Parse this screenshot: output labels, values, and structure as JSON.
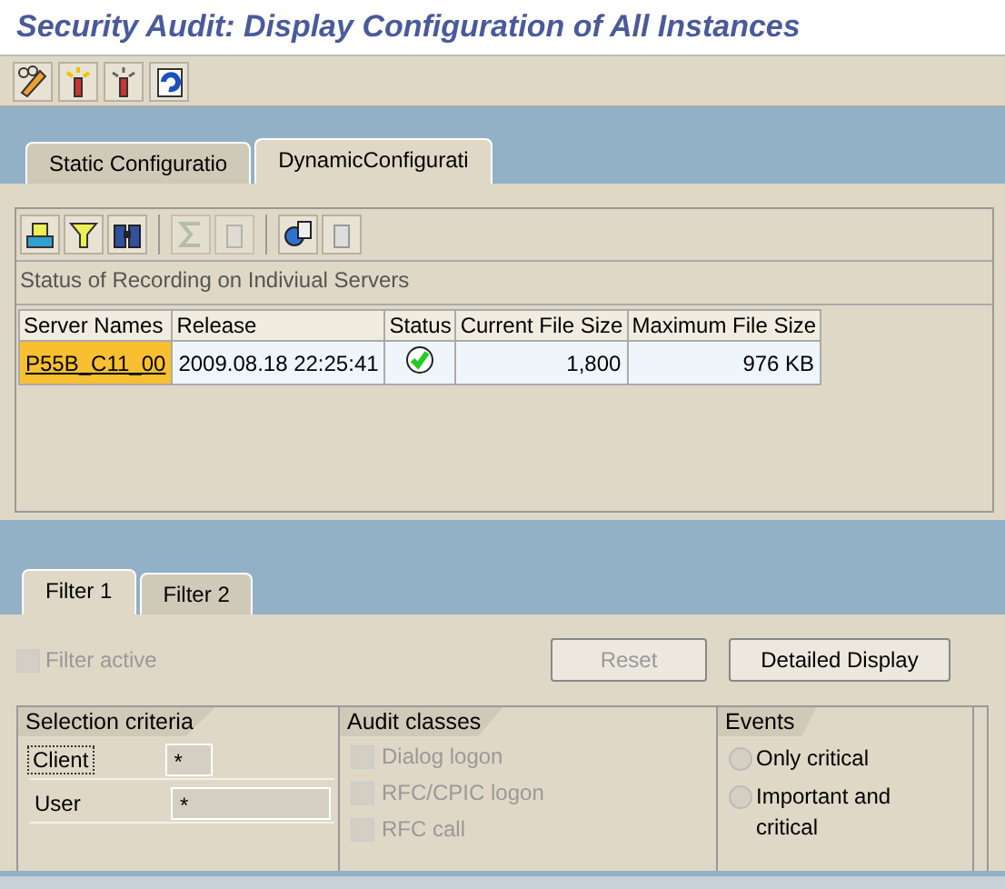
{
  "window": {
    "title": "Security Audit: Display Configuration of All Instances"
  },
  "tabs": [
    {
      "label": "Static Configuratio",
      "selected": false
    },
    {
      "label": "DynamicConfigurati",
      "selected": true
    }
  ],
  "grid": {
    "caption": "Status of Recording on Indiviual Servers",
    "columns": [
      "Server Names",
      "Release",
      "Status",
      "Current File Size",
      "Maximum File Size"
    ],
    "rows": [
      {
        "server_name": "P55B_C11_00",
        "release": "2009.08.18 22:25:41",
        "status_ok": true,
        "current_file_size": "1,800",
        "maximum_file_size": "976 KB"
      }
    ]
  },
  "filter_tabs": [
    {
      "label": "Filter 1",
      "selected": true
    },
    {
      "label": "Filter 2",
      "selected": false
    }
  ],
  "filter_active": {
    "label": "Filter active",
    "checked": false,
    "disabled": true
  },
  "buttons": [
    {
      "label": "Reset",
      "disabled": true
    },
    {
      "label": "Detailed Display",
      "disabled": false
    }
  ],
  "selection_criteria": {
    "title": "Selection criteria",
    "fields": [
      {
        "label": "Client",
        "value": "*",
        "focused": true
      },
      {
        "label": "User",
        "value": "*",
        "focused": false
      }
    ]
  },
  "audit_classes": {
    "title": "Audit classes",
    "items": [
      {
        "label": "Dialog logon",
        "checked": false
      },
      {
        "label": "RFC/CPIC logon",
        "checked": false
      },
      {
        "label": "RFC call",
        "checked": false
      }
    ]
  },
  "events": {
    "title": "Events",
    "options": [
      {
        "label": "Only critical",
        "selected": false
      },
      {
        "label": "Important and critical",
        "selected": false
      }
    ]
  }
}
